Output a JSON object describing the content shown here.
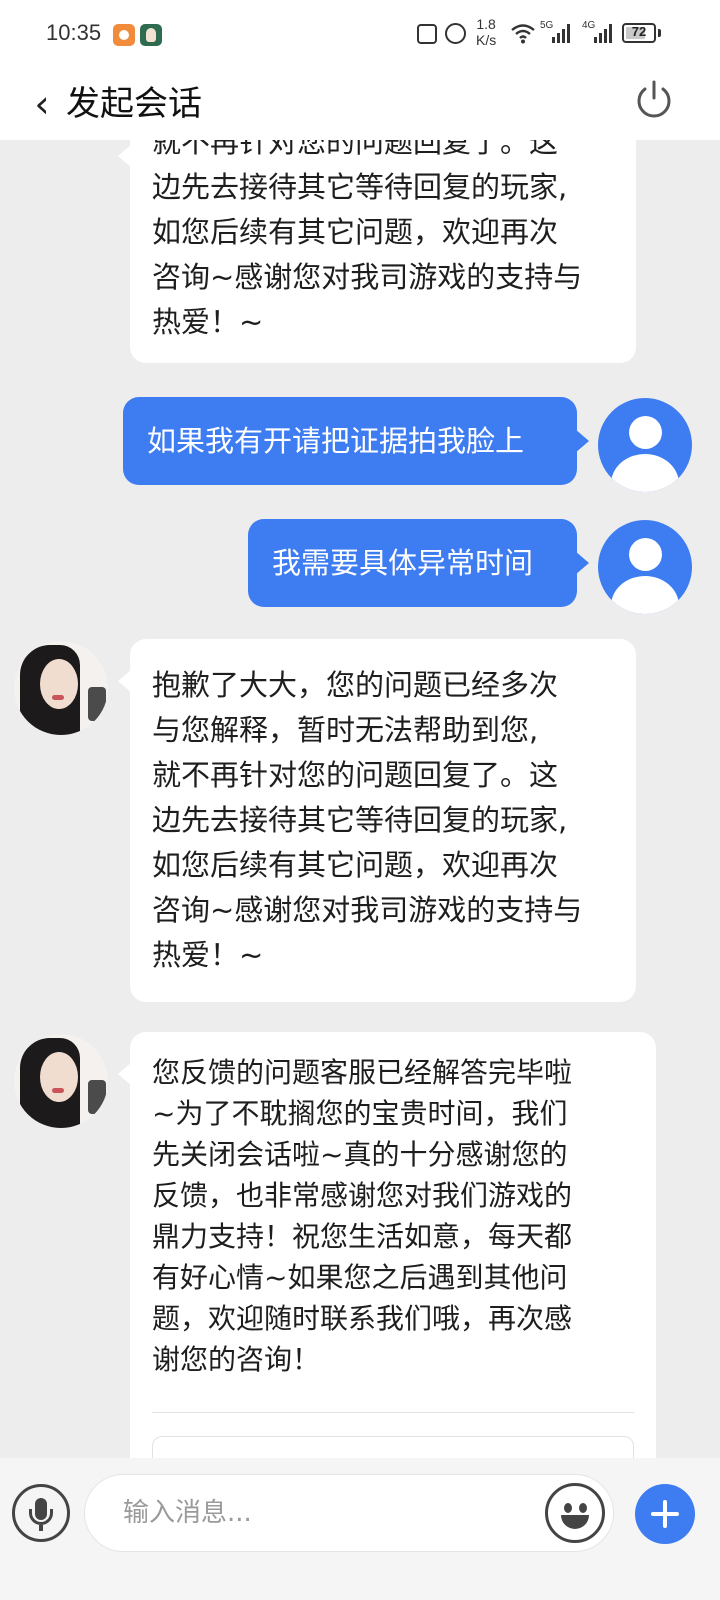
{
  "status_bar": {
    "time": "10:35",
    "network_speed_value": "1.8",
    "network_speed_unit": "K/s",
    "signal_1_label": "5G",
    "signal_2_label": "4G",
    "battery_percent": "72",
    "battery_level": 0.72
  },
  "header": {
    "title": "发起会话",
    "back_icon": "chevron-left-icon",
    "power_icon": "power-icon"
  },
  "messages": [
    {
      "sender": "agent",
      "text": "就不再针对您的问题回复了。这\n边先去接待其它等待回复的玩家,\n如您后续有其它问题，欢迎再次\n咨询~感谢您对我司游戏的支持与\n热爱！~"
    },
    {
      "sender": "user",
      "text": "如果我有开请把证据拍我脸上"
    },
    {
      "sender": "user",
      "text": "我需要具体异常时间"
    },
    {
      "sender": "agent",
      "text": "抱歉了大大，您的问题已经多次\n与您解释，暂时无法帮助到您,\n就不再针对您的问题回复了。这\n边先去接待其它等待回复的玩家,\n如您后续有其它问题，欢迎再次\n咨询~感谢您对我司游戏的支持与\n热爱！~"
    },
    {
      "sender": "agent",
      "text": "您反馈的问题客服已经解答完毕啦\n~为了不耽搁您的宝贵时间，我们\n先关闭会话啦~真的十分感谢您的\n反馈，也非常感谢您对我们游戏的\n鼎力支持！祝您生活如意，每天都\n有好心情~如果您之后遇到其他问\n题，欢迎随时联系我们哦，再次感\n谢您的咨询！"
    }
  ],
  "input_bar": {
    "placeholder": "输入消息...",
    "value": "",
    "mic_icon": "microphone-icon",
    "emoji_icon": "smiley-icon",
    "plus_icon": "plus-icon"
  },
  "colors": {
    "accent": "#3e7cf1",
    "chat_background": "#ededed",
    "bubble_agent": "#ffffff"
  }
}
